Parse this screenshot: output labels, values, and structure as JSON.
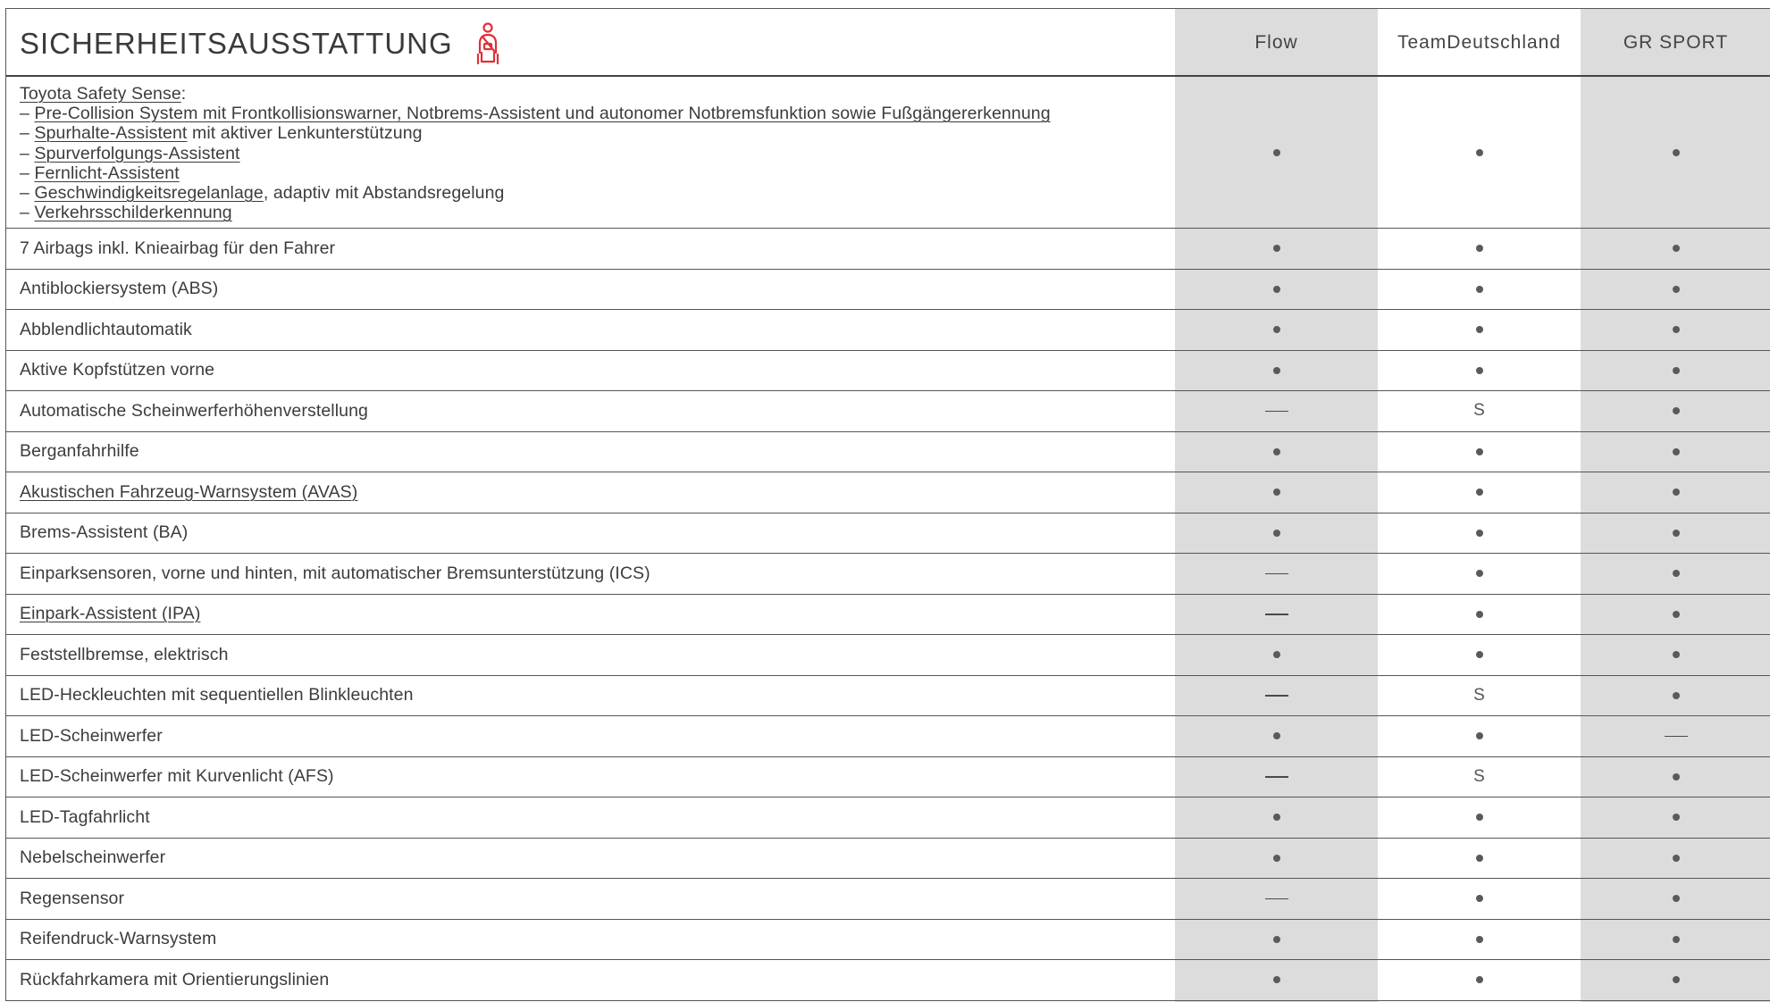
{
  "header": {
    "title": "SICHERHEITSAUSSTATTUNG",
    "icon": "seatbelt-icon",
    "icon_color": "#e0303a",
    "columns": [
      "Flow",
      "Team\nDeutschland",
      "GR SPORT"
    ]
  },
  "colors": {
    "shaded_column": "#dcdcdc",
    "rule": "#555555"
  },
  "safety_sense": {
    "title": "Toyota Safety Sense",
    "colon": ":",
    "items": [
      {
        "prefix": "– ",
        "link": "Pre-Collision System mit Frontkollisionswarner, Notbrems-Assistent und autonomer Notbremsfunktion sowie Fußgängererkennung",
        "suffix": ""
      },
      {
        "prefix": "– ",
        "link": "Spurhalte-Assistent",
        "suffix": " mit aktiver Lenkunterstützung"
      },
      {
        "prefix": "– ",
        "link": "Spurverfolgungs-Assistent",
        "suffix": ""
      },
      {
        "prefix": "– ",
        "link": "Fernlicht-Assistent",
        "suffix": ""
      },
      {
        "prefix": "– ",
        "link": "Geschwindigkeitsregelanlage",
        "suffix": ", adaptiv mit Abstandsregelung"
      },
      {
        "prefix": "– ",
        "link": "Verkehrsschilderkennung",
        "suffix": ""
      }
    ],
    "values": [
      "dot",
      "dot",
      "dot"
    ]
  },
  "rows": [
    {
      "label": "7 Airbags inkl. Knieairbag für den Fahrer",
      "link": false,
      "values": [
        "dot",
        "dot",
        "dot"
      ]
    },
    {
      "label": "Antiblockiersystem (ABS)",
      "link": false,
      "values": [
        "dot",
        "dot",
        "dot"
      ]
    },
    {
      "label": "Abblendlichtautomatik",
      "link": false,
      "values": [
        "dot",
        "dot",
        "dot"
      ]
    },
    {
      "label": "Aktive Kopfstützen vorne",
      "link": false,
      "values": [
        "dot",
        "dot",
        "dot"
      ]
    },
    {
      "label": "Automatische Scheinwerferhöhenverstellung",
      "link": false,
      "values": [
        "dash",
        "S",
        "dot"
      ]
    },
    {
      "label": "Berganfahrhilfe",
      "link": false,
      "values": [
        "dot",
        "dot",
        "dot"
      ]
    },
    {
      "label": "Akustischen Fahrzeug-Warnsystem (AVAS)",
      "link": true,
      "values": [
        "dot",
        "dot",
        "dot"
      ]
    },
    {
      "label": "Brems-Assistent (BA)",
      "link": false,
      "values": [
        "dot",
        "dot",
        "dot"
      ]
    },
    {
      "label": "Einparksensoren, vorne und hinten, mit automatischer Bremsunterstützung (ICS)",
      "link": false,
      "values": [
        "dash",
        "dot",
        "dot"
      ]
    },
    {
      "label": "Einpark-Assistent (IPA)",
      "link": true,
      "values": [
        "dash",
        "dot",
        "dot"
      ]
    },
    {
      "label": "Feststellbremse, elektrisch",
      "link": false,
      "values": [
        "dot",
        "dot",
        "dot"
      ]
    },
    {
      "label": "LED-Heckleuchten mit sequentiellen Blinkleuchten",
      "link": false,
      "values": [
        "dash",
        "S",
        "dot"
      ]
    },
    {
      "label": "LED-Scheinwerfer",
      "link": false,
      "values": [
        "dot",
        "dot",
        "dash"
      ]
    },
    {
      "label": "LED-Scheinwerfer mit Kurvenlicht (AFS)",
      "link": false,
      "values": [
        "dash",
        "S",
        "dot"
      ]
    },
    {
      "label": "LED-Tagfahrlicht",
      "link": false,
      "values": [
        "dot",
        "dot",
        "dot"
      ]
    },
    {
      "label": "Nebelscheinwerfer",
      "link": false,
      "values": [
        "dot",
        "dot",
        "dot"
      ]
    },
    {
      "label": "Regensensor",
      "link": false,
      "values": [
        "dash",
        "dot",
        "dot"
      ]
    },
    {
      "label": "Reifendruck-Warnsystem",
      "link": false,
      "values": [
        "dot",
        "dot",
        "dot"
      ]
    },
    {
      "label": "Rückfahrkamera mit Orientierungslinien",
      "link": false,
      "values": [
        "dot",
        "dot",
        "dot"
      ]
    }
  ]
}
